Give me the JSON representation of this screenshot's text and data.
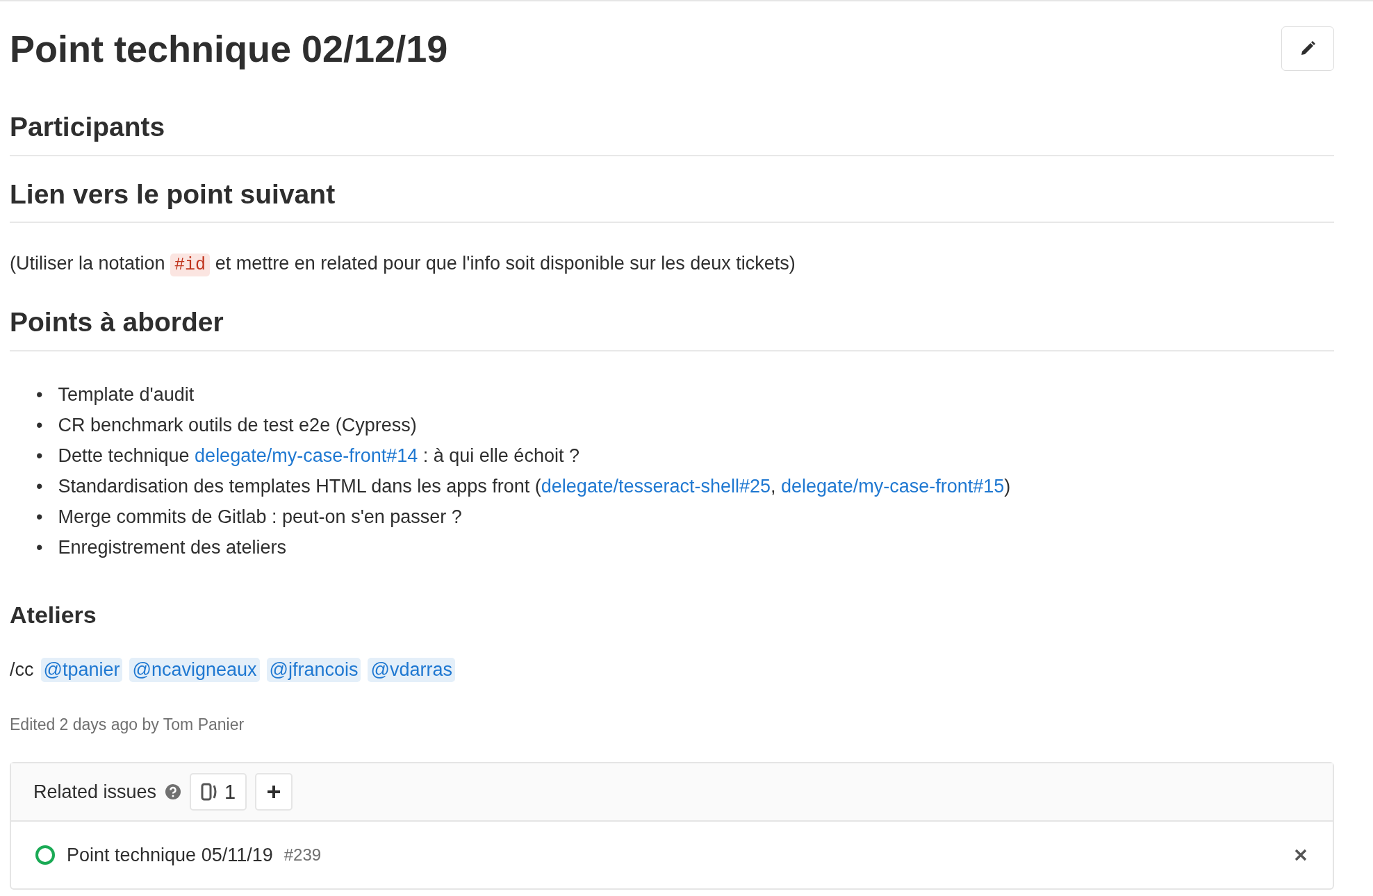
{
  "title": "Point technique 02/12/19",
  "sections": [
    {
      "heading": "Participants",
      "kind": "major"
    },
    {
      "heading": "Lien vers le point suivant",
      "kind": "major",
      "blocks": [
        {
          "kind": "paragraph",
          "segments": [
            {
              "kind": "text",
              "text": "(Utiliser la notation "
            },
            {
              "kind": "code",
              "text": "#id"
            },
            {
              "kind": "text",
              "text": " et mettre en related pour que l'info soit disponible sur les deux tickets)"
            }
          ]
        }
      ]
    },
    {
      "heading": "Points à aborder",
      "kind": "major",
      "blocks": [
        {
          "kind": "list",
          "marker": "•",
          "items": [
            [
              {
                "kind": "text",
                "text": "Template d'audit"
              }
            ],
            [
              {
                "kind": "text",
                "text": "CR benchmark outils de test e2e (Cypress)"
              }
            ],
            [
              {
                "kind": "text",
                "text": "Dette technique "
              },
              {
                "kind": "link",
                "text": "delegate/my-case-front#14"
              },
              {
                "kind": "text",
                "text": " : à qui elle échoit ?"
              }
            ],
            [
              {
                "kind": "text",
                "text": "Standardisation des templates HTML dans les apps front ("
              },
              {
                "kind": "link",
                "text": "delegate/tesseract-shell#25"
              },
              {
                "kind": "text",
                "text": ", "
              },
              {
                "kind": "link",
                "text": "delegate/my-case-front#15"
              },
              {
                "kind": "text",
                "text": ")"
              }
            ],
            [
              {
                "kind": "text",
                "text": "Merge commits de Gitlab : peut-on s'en passer ?"
              }
            ],
            [
              {
                "kind": "text",
                "text": "Enregistrement des ateliers"
              }
            ]
          ]
        }
      ]
    },
    {
      "heading": "Ateliers",
      "kind": "minor",
      "blocks": [
        {
          "kind": "mentions",
          "prefix": "/cc",
          "users": [
            "@tpanier",
            "@ncavigneaux",
            "@jfrancois",
            "@vdarras"
          ]
        }
      ]
    }
  ],
  "edited": "Edited 2 days ago by Tom Panier",
  "related": {
    "title": "Related issues",
    "count": "1",
    "issues": [
      {
        "title": "Point technique 05/11/19",
        "number": "#239"
      }
    ]
  }
}
